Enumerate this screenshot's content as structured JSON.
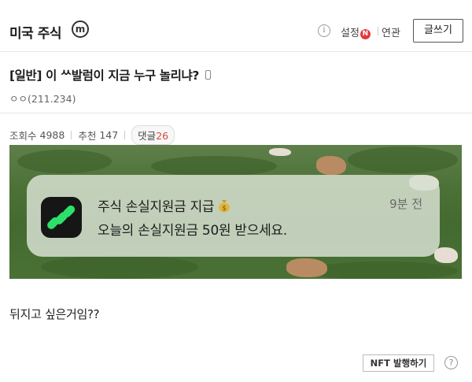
{
  "header": {
    "board_title": "미국 주식",
    "minor_badge": "m",
    "info_icon_glyph": "i",
    "settings_label": "설정",
    "settings_badge": "N",
    "related_label": "연관",
    "write_button": "글쓰기"
  },
  "post": {
    "title": "[일반] 이 ᄊ발럼이 지금 누구 놀리냐?",
    "author": "ㅇㅇ(211.234)",
    "views_label": "조회수",
    "views": "4988",
    "recommend_label": "추천",
    "recommend": "147",
    "comments_label": "댓글",
    "comments": "26",
    "body_text": "뒤지고 싶은거임??",
    "nft_button": "NFT 발행하기",
    "help_glyph": "?"
  },
  "notification": {
    "title": "주식 손실지원금 지급",
    "time": "9분 전",
    "body": "오늘의 손실지원금 50원 받으세요.",
    "icon": "moneybag-icon",
    "app_icon": "stock-app-icon"
  },
  "colors": {
    "badge_red": "#e23b3b",
    "comment_count": "#d8483d",
    "grass_green": "#4d7238"
  }
}
